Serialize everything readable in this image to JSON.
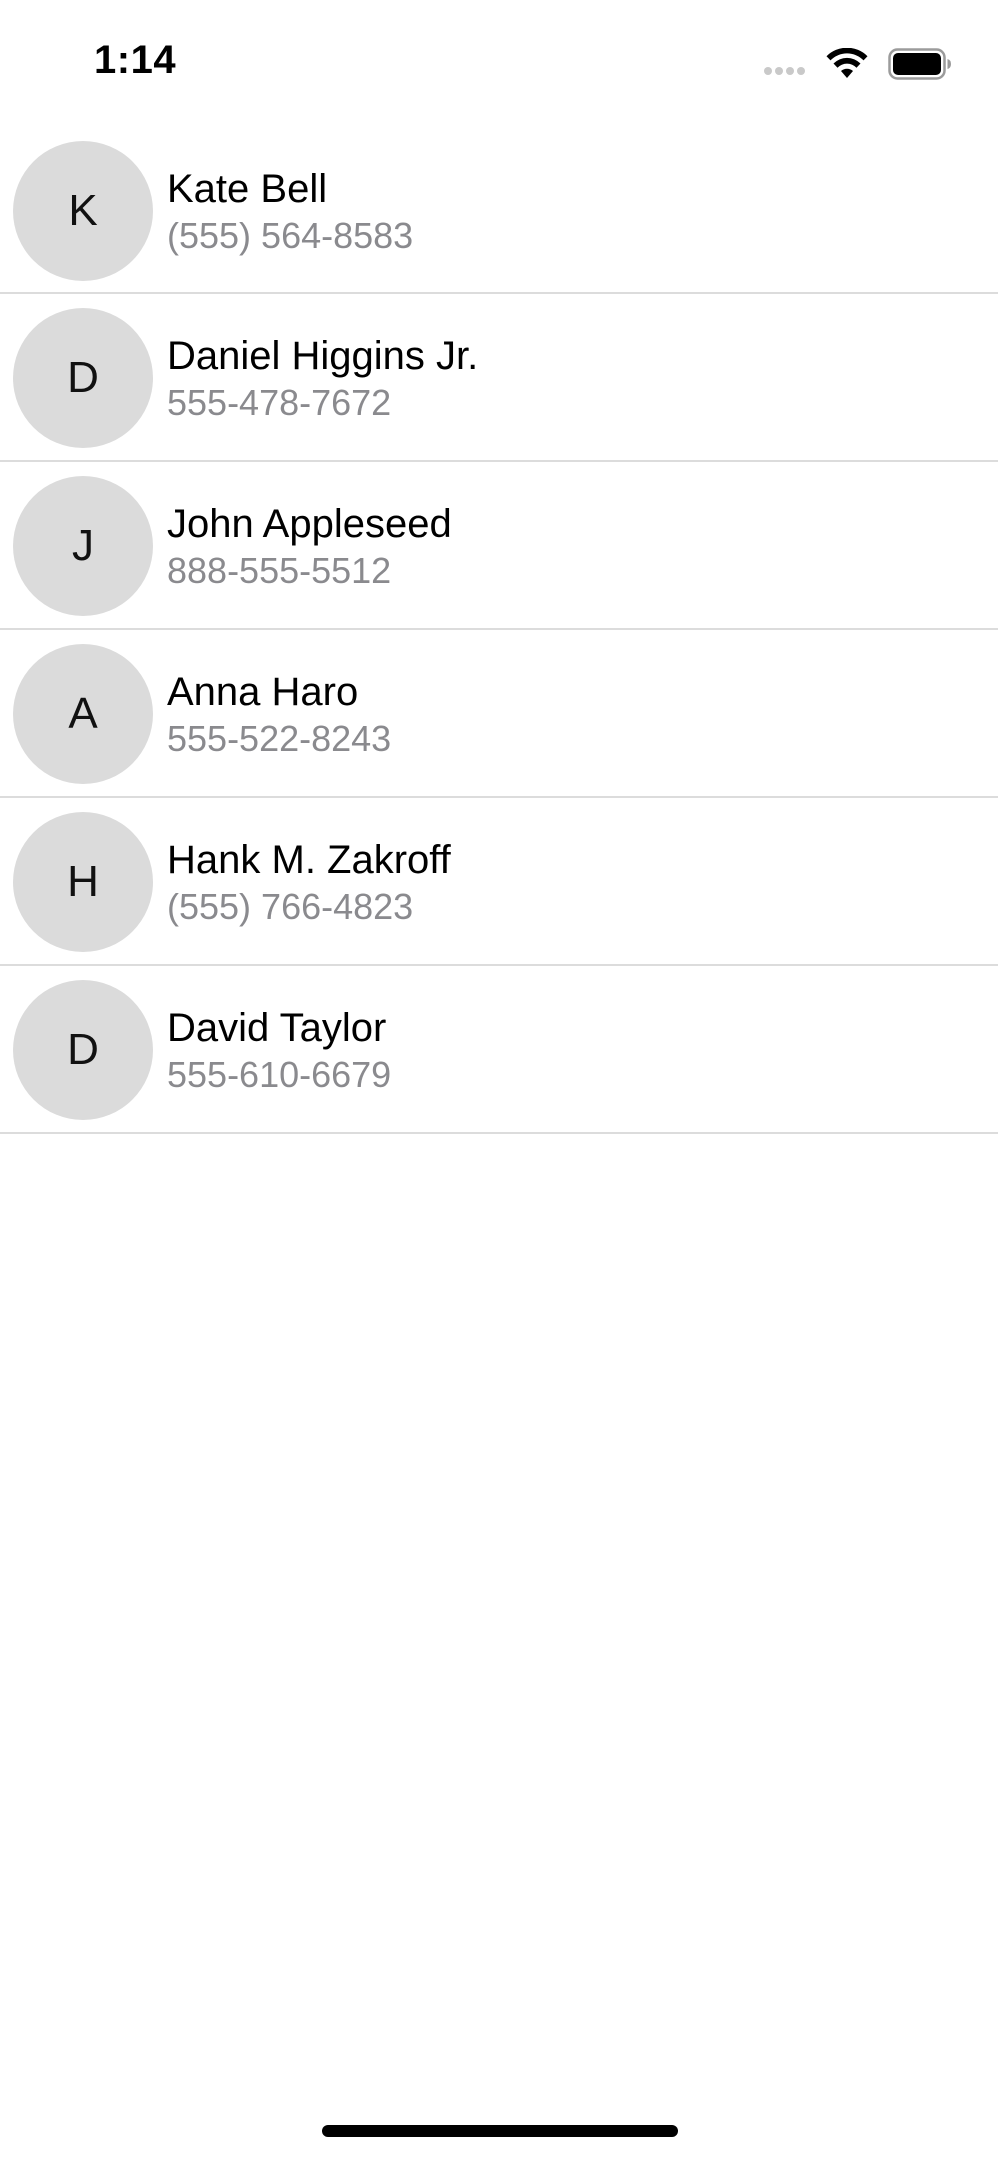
{
  "status_bar": {
    "time": "1:14"
  },
  "contacts": [
    {
      "initial": "K",
      "name": "Kate Bell",
      "phone": "(555) 564-8583"
    },
    {
      "initial": "D",
      "name": "Daniel Higgins Jr.",
      "phone": "555-478-7672"
    },
    {
      "initial": "J",
      "name": "John Appleseed",
      "phone": "888-555-5512"
    },
    {
      "initial": "A",
      "name": "Anna Haro",
      "phone": "555-522-8243"
    },
    {
      "initial": "H",
      "name": "Hank M. Zakroff",
      "phone": "(555) 766-4823"
    },
    {
      "initial": "D",
      "name": "David Taylor",
      "phone": "555-610-6679"
    }
  ],
  "icons": {
    "signal": "cellular-signal-icon",
    "wifi": "wifi-icon",
    "battery": "battery-icon"
  },
  "colors": {
    "avatar_background": "#dbdbdb",
    "secondary_text": "#8a8a8e",
    "separator": "#dcdcdc"
  }
}
